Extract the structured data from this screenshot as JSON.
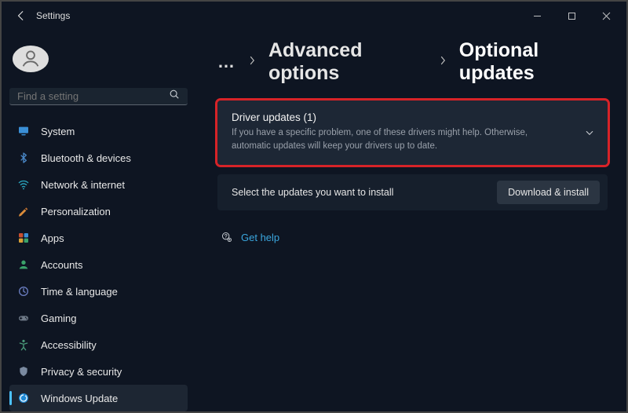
{
  "titlebar": {
    "app_title": "Settings"
  },
  "search": {
    "placeholder": "Find a setting"
  },
  "nav": {
    "items": [
      {
        "name": "system",
        "label": "System",
        "color": "#3a8fd6"
      },
      {
        "name": "bluetooth-devices",
        "label": "Bluetooth & devices",
        "color": "#4a88c8"
      },
      {
        "name": "network-internet",
        "label": "Network & internet",
        "color": "#2aa6c0"
      },
      {
        "name": "personalization",
        "label": "Personalization",
        "color": "#d98b3a"
      },
      {
        "name": "apps",
        "label": "Apps",
        "color": "#c84f30"
      },
      {
        "name": "accounts",
        "label": "Accounts",
        "color": "#3aa36a"
      },
      {
        "name": "time-language",
        "label": "Time & language",
        "color": "#6a7dc0"
      },
      {
        "name": "gaming",
        "label": "Gaming",
        "color": "#6f7a88"
      },
      {
        "name": "accessibility",
        "label": "Accessibility",
        "color": "#4a9a7a"
      },
      {
        "name": "privacy-security",
        "label": "Privacy & security",
        "color": "#7a8aa0"
      },
      {
        "name": "windows-update",
        "label": "Windows Update",
        "color": "#1f8ad6",
        "active": true
      }
    ]
  },
  "breadcrumb": {
    "more": "…",
    "advanced": "Advanced options",
    "current": "Optional updates"
  },
  "panel": {
    "title": "Driver updates (1)",
    "desc": "If you have a specific problem, one of these drivers might help. Otherwise, automatic updates will keep your drivers up to date."
  },
  "selectbar": {
    "text": "Select the updates you want to install",
    "button": "Download & install"
  },
  "help": {
    "label": "Get help"
  }
}
